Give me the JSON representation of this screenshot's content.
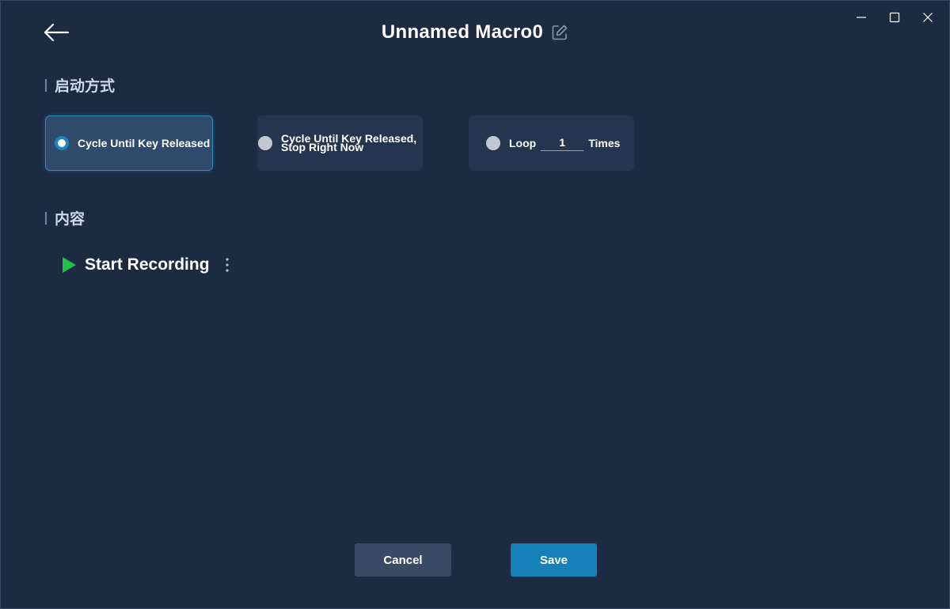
{
  "header": {
    "title": "Unnamed Macro0",
    "back_icon": "arrow-left-icon",
    "edit_icon": "pencil-edit-icon"
  },
  "window_controls": {
    "minimize_icon": "minimize-icon",
    "maximize_icon": "maximize-icon",
    "close_icon": "close-icon"
  },
  "trigger_section": {
    "heading": "启动方式",
    "options": [
      {
        "label": "Cycle Until Key Released",
        "selected": true
      },
      {
        "label_line1": "Cycle Until Key Released,",
        "label_line2": "Stop Right Now",
        "selected": false
      },
      {
        "label_prefix": "Loop",
        "loop_value": "1",
        "label_suffix": "Times",
        "selected": false
      }
    ]
  },
  "content_section": {
    "heading": "内容",
    "record_label": "Start Recording",
    "record_icon": "play-icon",
    "more_icon": "more-vertical-icon"
  },
  "footer": {
    "cancel_label": "Cancel",
    "save_label": "Save"
  },
  "colors": {
    "background": "#1c2a42",
    "accent": "#1481b8",
    "play_green": "#22c04a"
  }
}
